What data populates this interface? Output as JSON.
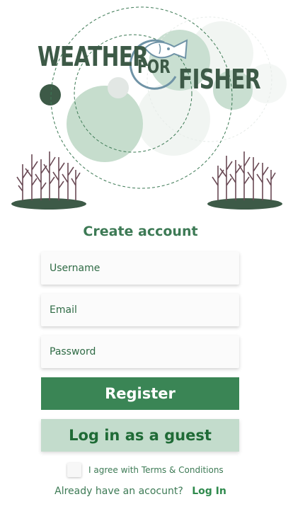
{
  "logo": {
    "word1": "WEATHER",
    "word2": "FOR",
    "word3": "FISHER"
  },
  "form": {
    "title": "Create account",
    "username_placeholder": "Username",
    "email_placeholder": "Email",
    "password_placeholder": "Password",
    "register_label": "Register",
    "guest_label": "Log in as a guest",
    "agree_text": "I agree with Terms & Conditions",
    "have_account_text": "Already have an acocunt?",
    "login_label": "Log In"
  },
  "colors": {
    "primary": "#3a8555",
    "secondary": "#c3dccc",
    "text_green": "#3d7a55",
    "logo_dark": "#3d5a47"
  },
  "icons": [
    "fish-icon",
    "tree-icon"
  ]
}
